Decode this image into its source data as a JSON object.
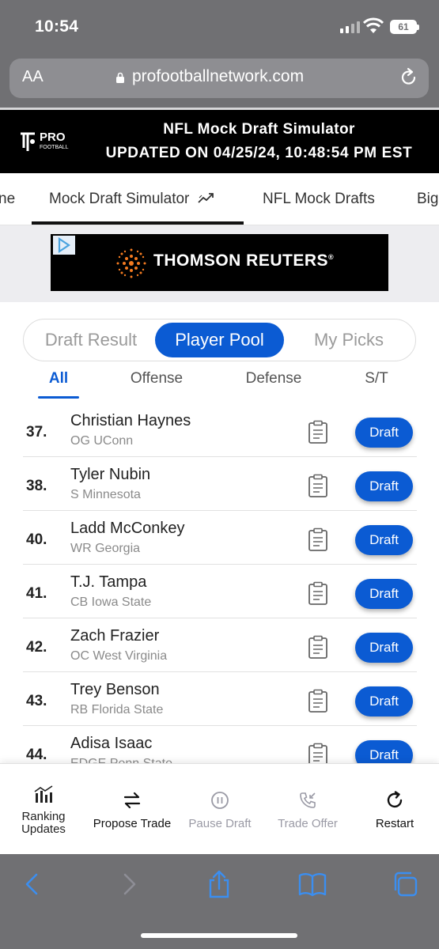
{
  "status_bar": {
    "time": "10:54",
    "battery": "61"
  },
  "browser": {
    "text_size_label": "AA",
    "url": "profootballnetwork.com"
  },
  "site_header": {
    "logo_text": "PRO",
    "logo_sub": "FOOTBALL",
    "title": "NFL Mock Draft Simulator",
    "updated": "UPDATED ON 04/25/24, 10:48:54 PM EST"
  },
  "nav": {
    "tabs": [
      {
        "label": "ne"
      },
      {
        "label": "Mock Draft Simulator"
      },
      {
        "label": "NFL Mock Drafts"
      },
      {
        "label": "Big"
      }
    ],
    "active_index": 1
  },
  "ad": {
    "brand": "THOMSON REUTERS",
    "registered": "®"
  },
  "segment": {
    "options": [
      {
        "label": "Draft Result"
      },
      {
        "label": "Player Pool"
      },
      {
        "label": "My Picks"
      }
    ],
    "active": "Player Pool"
  },
  "filters": {
    "tabs": [
      {
        "label": "All"
      },
      {
        "label": "Offense"
      },
      {
        "label": "Defense"
      },
      {
        "label": "S/T"
      }
    ],
    "active": "All"
  },
  "players": [
    {
      "rank": "37.",
      "name": "Christian Haynes",
      "info": "OG UConn",
      "button": "Draft"
    },
    {
      "rank": "38.",
      "name": "Tyler Nubin",
      "info": "S Minnesota",
      "button": "Draft"
    },
    {
      "rank": "40.",
      "name": "Ladd McConkey",
      "info": "WR Georgia",
      "button": "Draft"
    },
    {
      "rank": "41.",
      "name": "T.J. Tampa",
      "info": "CB Iowa State",
      "button": "Draft"
    },
    {
      "rank": "42.",
      "name": "Zach Frazier",
      "info": "OC West Virginia",
      "button": "Draft"
    },
    {
      "rank": "43.",
      "name": "Trey Benson",
      "info": "RB Florida State",
      "button": "Draft"
    },
    {
      "rank": "44.",
      "name": "Adisa Isaac",
      "info": "EDGE Penn State",
      "button": "Draft"
    }
  ],
  "toolbar": {
    "ranking": "Ranking Updates",
    "ranking_l1": "Ranking",
    "ranking_l2": "Updates",
    "propose": "Propose Trade",
    "pause": "Pause Draft",
    "trade_offer": "Trade Offer",
    "restart": "Restart"
  },
  "colors": {
    "accent": "#0b5bd3",
    "header_bg": "#000000",
    "safari_chrome": "#707073"
  }
}
